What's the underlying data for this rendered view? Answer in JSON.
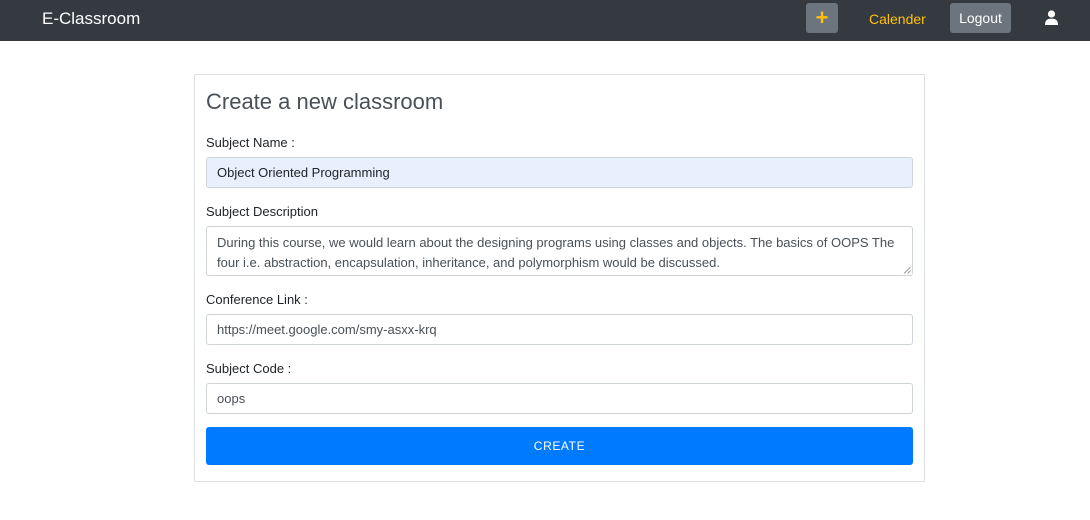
{
  "navbar": {
    "brand": "E-Classroom",
    "add_label": "+",
    "calendar_label": "Calender",
    "logout_label": "Logout",
    "user_icon": "user-icon"
  },
  "form": {
    "title": "Create a new classroom",
    "subject_name": {
      "label": "Subject Name :",
      "value": "Object Oriented Programming"
    },
    "subject_description": {
      "label": "Subject Description",
      "value": "During this course, we would learn about the designing programs using classes and objects. The basics of OOPS The four i.e. abstraction, encapsulation, inheritance, and polymorphism would be discussed."
    },
    "conference_link": {
      "label": "Conference Link :",
      "value": "https://meet.google.com/smy-asxx-krq"
    },
    "subject_code": {
      "label": "Subject Code :",
      "value": "oops"
    },
    "submit_label": "CREATE"
  },
  "colors": {
    "navbar_bg": "#343a40",
    "accent_yellow": "#ffc107",
    "button_gray": "#6c757d",
    "primary_blue": "#007bff",
    "autofill_bg": "#e8f0fe"
  }
}
